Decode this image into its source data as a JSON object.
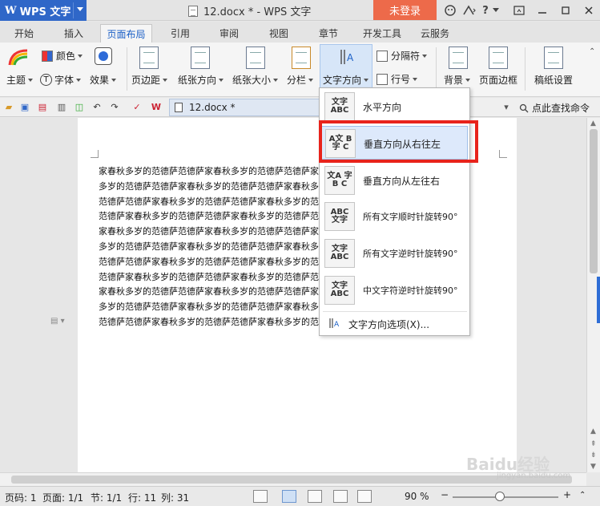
{
  "titlebar": {
    "app_name": "WPS 文字",
    "doc_title": "12.docx * - WPS 文字",
    "login_label": "未登录",
    "icons": [
      "skin-icon",
      "share-icon",
      "help-icon",
      "dropdown-icon"
    ],
    "window_controls": [
      "minimize",
      "maximize",
      "close"
    ]
  },
  "tabs": [
    {
      "label": "开始"
    },
    {
      "label": "插入"
    },
    {
      "label": "页面布局",
      "active": true
    },
    {
      "label": "引用"
    },
    {
      "label": "审阅"
    },
    {
      "label": "视图"
    },
    {
      "label": "章节"
    },
    {
      "label": "开发工具"
    },
    {
      "label": "云服务"
    }
  ],
  "ribbon": {
    "theme": "主题",
    "color": "颜色",
    "font": "字体",
    "effect": "效果",
    "margins": "页边距",
    "orientation": "纸张方向",
    "size": "纸张大小",
    "columns": "分栏",
    "text_direction": "文字方向",
    "breaks": "分隔符",
    "line_numbers": "行号",
    "background": "背景",
    "page_border": "页面边框",
    "manuscript": "稿纸设置"
  },
  "quickbar": {
    "doc_tab": "12.docx *",
    "search_label": "点此查找命令"
  },
  "document": {
    "lines": [
      "家春秋多岁的范德萨范德萨家春秋多岁的范德萨范德萨家春秋多岁的范德萨范德萨家春秋",
      "多岁的范德萨范德萨家春秋多岁的范德萨范德萨家春秋多岁的范德萨范德萨家春秋多岁的",
      "范德萨范德萨家春秋多岁的范德萨范德萨家春秋多岁的范德萨范德萨家春秋多岁的范德萨",
      "范德萨家春秋多岁的范德萨范德萨家春秋多岁的范德萨范德萨家春秋多岁的范德萨范德萨",
      "家春秋多岁的范德萨范德萨家春秋多岁的范德萨范德萨家春秋多岁的范德萨范德萨家春秋",
      "多岁的范德萨范德萨家春秋多岁的范德萨范德萨家春秋多岁的范德萨范德萨家春秋多岁的",
      "范德萨范德萨家春秋多岁的范德萨范德萨家春秋多岁的范德萨范德萨家春秋多岁的范德萨",
      "范德萨家春秋多岁的范德萨范德萨家春秋多岁的范德萨范德萨家春秋多岁的范德萨范德萨",
      "家春秋多岁的范德萨范德萨家春秋多岁的范德萨范德萨家春秋多岁的范德萨范德萨家春秋",
      "多岁的范德萨范德萨家春秋多岁的范德萨范德萨家春秋多岁的范德萨范德萨家春秋多岁的",
      "范德萨范德萨家春秋多岁的范德萨范德萨家春秋多岁的范德萨"
    ]
  },
  "dropdown": {
    "items": [
      {
        "label": "水平方向",
        "icon_text": "文字 ABC"
      },
      {
        "label": "垂直方向从右往左",
        "icon_text": "A文 B字 C",
        "highlighted": true
      },
      {
        "label": "垂直方向从左往右",
        "icon_text": "文A 字B C"
      },
      {
        "label": "所有文字顺时针旋转90°",
        "icon_text": "ABC 文字"
      },
      {
        "label": "所有文字逆时针旋转90°",
        "icon_text": "文字 ABC"
      },
      {
        "label": "中文字符逆时针旋转90°",
        "icon_text": "文字 ABC"
      }
    ],
    "options_label": "文字方向选项(X)..."
  },
  "statusbar": {
    "page_code": "页码: 1",
    "page": "页面: 1/1",
    "section": "节: 1/1",
    "row": "行: 11",
    "col": "列: 31",
    "zoom": "90 %",
    "zoom_level": 0.45
  },
  "watermark": {
    "text": "Baidu经验",
    "sub": "jingyan.baidu.com"
  },
  "colors": {
    "accent": "#2f67c8",
    "login": "#ed6a4a",
    "highlight_box": "#e8231b",
    "menu_highlight": "#dde9fb"
  }
}
